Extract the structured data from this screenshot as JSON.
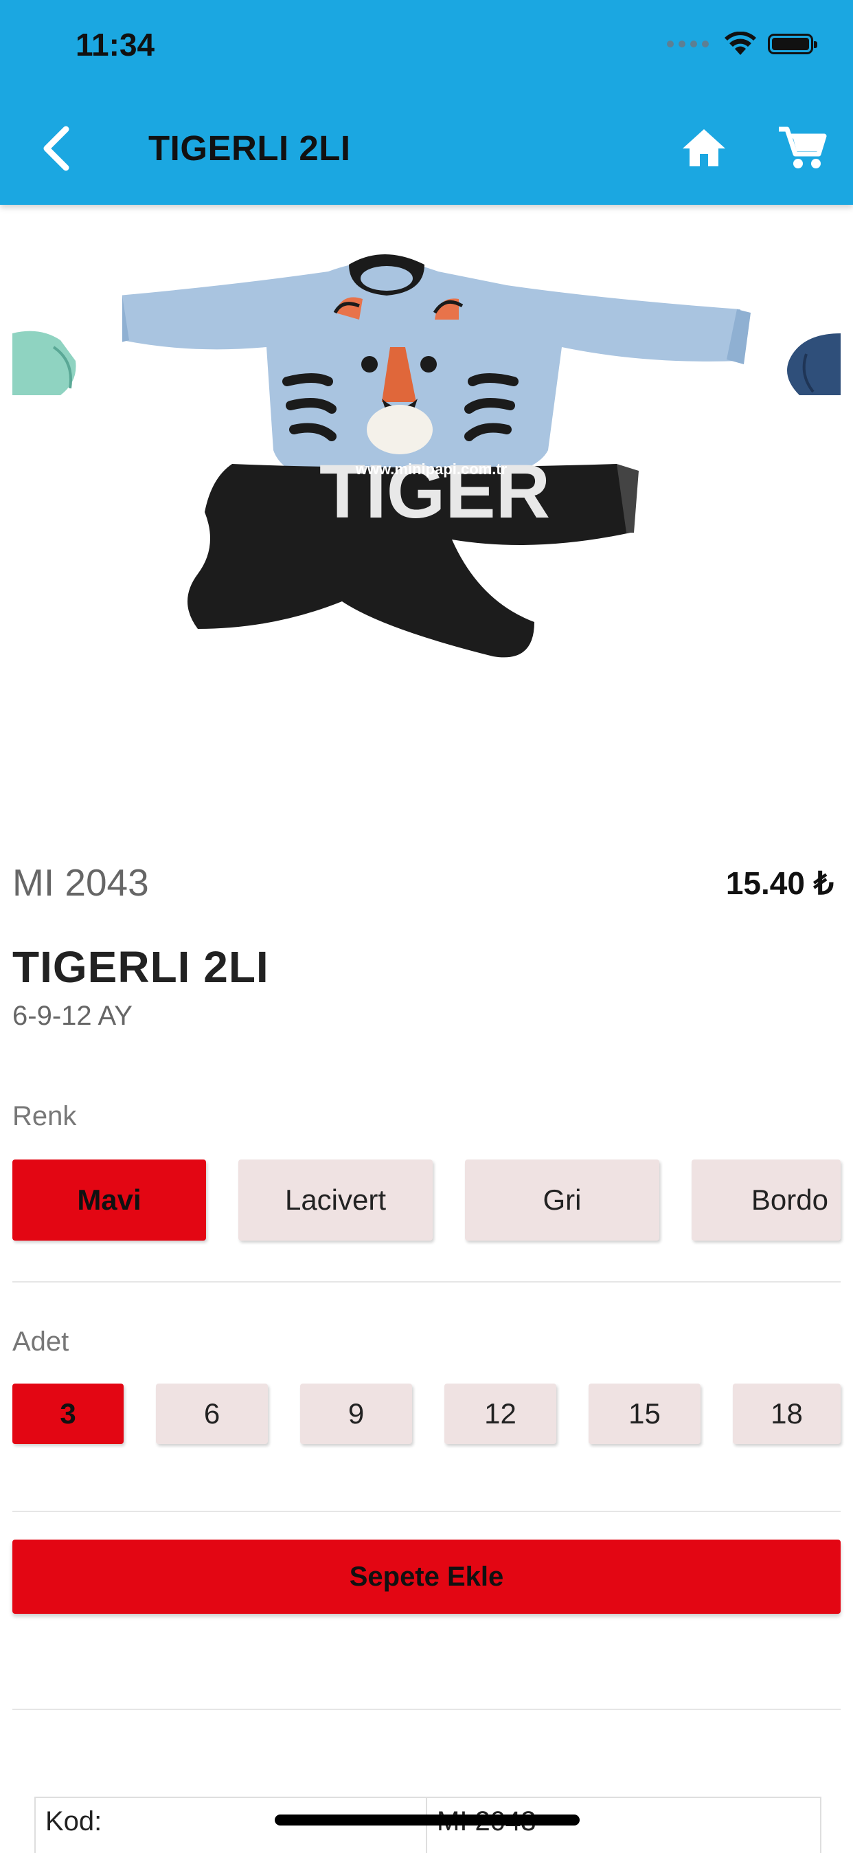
{
  "status_bar": {
    "time": "11:34"
  },
  "header": {
    "title": "TIGERLI 2LI",
    "back_icon": "chevron-left-icon",
    "home_icon": "home-icon",
    "cart_icon": "cart-icon"
  },
  "product": {
    "code": "MI 2043",
    "price": "15.40 ₺",
    "name": "TIGERLI 2LI",
    "sizes": "6-9-12 AY",
    "image_watermark": "www.minipapi.com.tr",
    "image_print_text": "TIGER"
  },
  "color_section": {
    "label": "Renk",
    "options": [
      "Mavi",
      "Lacivert",
      "Gri",
      "Bordo"
    ],
    "selected": "Mavi"
  },
  "quantity_section": {
    "label": "Adet",
    "options": [
      "3",
      "6",
      "9",
      "12",
      "15",
      "18"
    ],
    "selected": "3"
  },
  "actions": {
    "add_to_cart": "Sepete Ekle"
  },
  "details": {
    "rows": [
      {
        "key": "Kod:",
        "value": "MI 2043"
      }
    ]
  },
  "colors": {
    "header": "#1ba7e1",
    "accent": "#e30613",
    "chip": "#efe2e2"
  }
}
